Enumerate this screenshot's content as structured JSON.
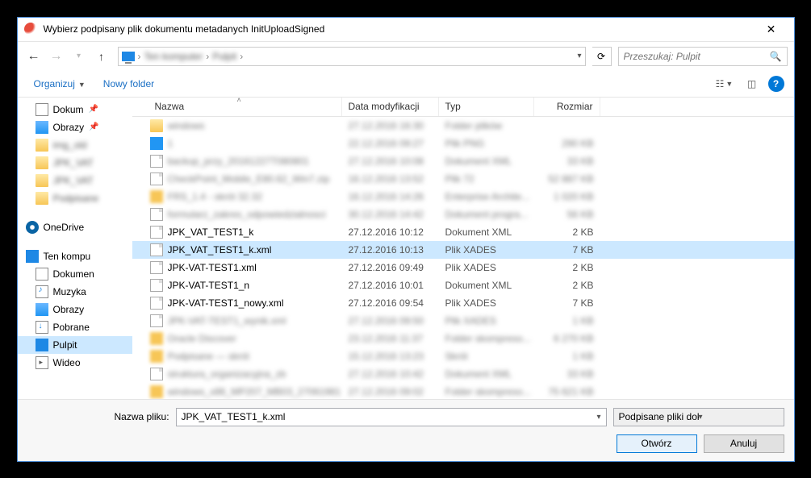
{
  "window": {
    "title": "Wybierz podpisany plik dokumentu metadanych InitUploadSigned"
  },
  "nav": {
    "breadcrumb1": "Ten komputer",
    "breadcrumb2": "Pulpit"
  },
  "search": {
    "placeholder": "Przeszukaj: Pulpit"
  },
  "toolbar": {
    "organize": "Organizuj",
    "newfolder": "Nowy folder"
  },
  "sidebar": {
    "quick": [
      {
        "label": "Dokum",
        "icon": "docs",
        "pinned": true
      },
      {
        "label": "Obrazy",
        "icon": "img",
        "pinned": true
      },
      {
        "label": "img_old",
        "icon": "folder",
        "blur": true
      },
      {
        "label": "JPK_VAT",
        "icon": "folder",
        "blur": true
      },
      {
        "label": "JPK_VAT",
        "icon": "folder",
        "blur": true
      },
      {
        "label": "Podpisane",
        "icon": "folder",
        "blur": true
      }
    ],
    "onedrive": "OneDrive",
    "thispc": "Ten kompu",
    "thispc_children": [
      {
        "label": "Dokumen",
        "icon": "docs"
      },
      {
        "label": "Muzyka",
        "icon": "music"
      },
      {
        "label": "Obrazy",
        "icon": "img"
      },
      {
        "label": "Pobrane",
        "icon": "down"
      },
      {
        "label": "Pulpit",
        "icon": "desktop",
        "selected": true
      },
      {
        "label": "Wideo",
        "icon": "video"
      }
    ]
  },
  "columns": {
    "name": "Nazwa",
    "date": "Data modyfikacji",
    "type": "Typ",
    "size": "Rozmiar"
  },
  "files": [
    {
      "name": "windows",
      "date": "27.12.2016 16:30",
      "type": "Folder plików",
      "size": "",
      "icon": "folder",
      "blur": true
    },
    {
      "name": "1",
      "date": "22.12.2016 09:27",
      "type": "Plik PNG",
      "size": "290 KB",
      "icon": "blue",
      "blur": true
    },
    {
      "name": "backup_przy_20161227T080801",
      "date": "27.12.2016 10:08",
      "type": "Dokument XML",
      "size": "33 KB",
      "icon": "xml",
      "blur": true
    },
    {
      "name": "CheckPoint_Mobile_E80.62_Win7.zip",
      "date": "16.12.2016 13:52",
      "type": "Plik 72",
      "size": "52 887 KB",
      "icon": "xml",
      "blur": true
    },
    {
      "name": "FRS_1.4 - skrót 32.32",
      "date": "16.12.2016 14:26",
      "type": "Enterprise Archite...",
      "size": "1 020 KB",
      "icon": "blur",
      "blur": true
    },
    {
      "name": "formularz_zakres_odpowiedzialnosci",
      "date": "30.12.2016 14:42",
      "type": "Dokument progra...",
      "size": "56 KB",
      "icon": "xml",
      "blur": true
    },
    {
      "name": "JPK_VAT_TEST1_k",
      "date": "27.12.2016 10:12",
      "type": "Dokument XML",
      "size": "2 KB",
      "icon": "xml"
    },
    {
      "name": "JPK_VAT_TEST1_k.xml",
      "date": "27.12.2016 10:13",
      "type": "Plik XADES",
      "size": "7 KB",
      "icon": "xml",
      "selected": true
    },
    {
      "name": "JPK-VAT-TEST1.xml",
      "date": "27.12.2016 09:49",
      "type": "Plik XADES",
      "size": "2 KB",
      "icon": "xml"
    },
    {
      "name": "JPK-VAT-TEST1_n",
      "date": "27.12.2016 10:01",
      "type": "Dokument XML",
      "size": "2 KB",
      "icon": "xml"
    },
    {
      "name": "JPK-VAT-TEST1_nowy.xml",
      "date": "27.12.2016 09:54",
      "type": "Plik XADES",
      "size": "7 KB",
      "icon": "xml"
    },
    {
      "name": "JPK-VAT-TEST1_wynik.xml",
      "date": "27.12.2016 09:50",
      "type": "Plik XADES",
      "size": "1 KB",
      "icon": "xml",
      "blur": true
    },
    {
      "name": "Oracle Discover",
      "date": "23.12.2016 11:37",
      "type": "Folder skompreso...",
      "size": "6 270 KB",
      "icon": "blur",
      "blur": true
    },
    {
      "name": "Podpisane — skrót",
      "date": "15.12.2016 13:23",
      "type": "Skrót",
      "size": "1 KB",
      "icon": "blur",
      "blur": true
    },
    {
      "name": "struktura_organizacyjna_zb",
      "date": "27.12.2016 10:42",
      "type": "Dokument XML",
      "size": "33 KB",
      "icon": "xml",
      "blur": true
    },
    {
      "name": "windows_x86_MP207_MB03_27061981",
      "date": "27.12.2016 09:02",
      "type": "Folder skompreso...",
      "size": "75 621 KB",
      "icon": "blur",
      "blur": true
    }
  ],
  "footer": {
    "filename_label": "Nazwa pliku:",
    "filename_value": "JPK_VAT_TEST1_k.xml",
    "filter": "Podpisane pliki dokumentu me",
    "open": "Otwórz",
    "cancel": "Anuluj"
  }
}
